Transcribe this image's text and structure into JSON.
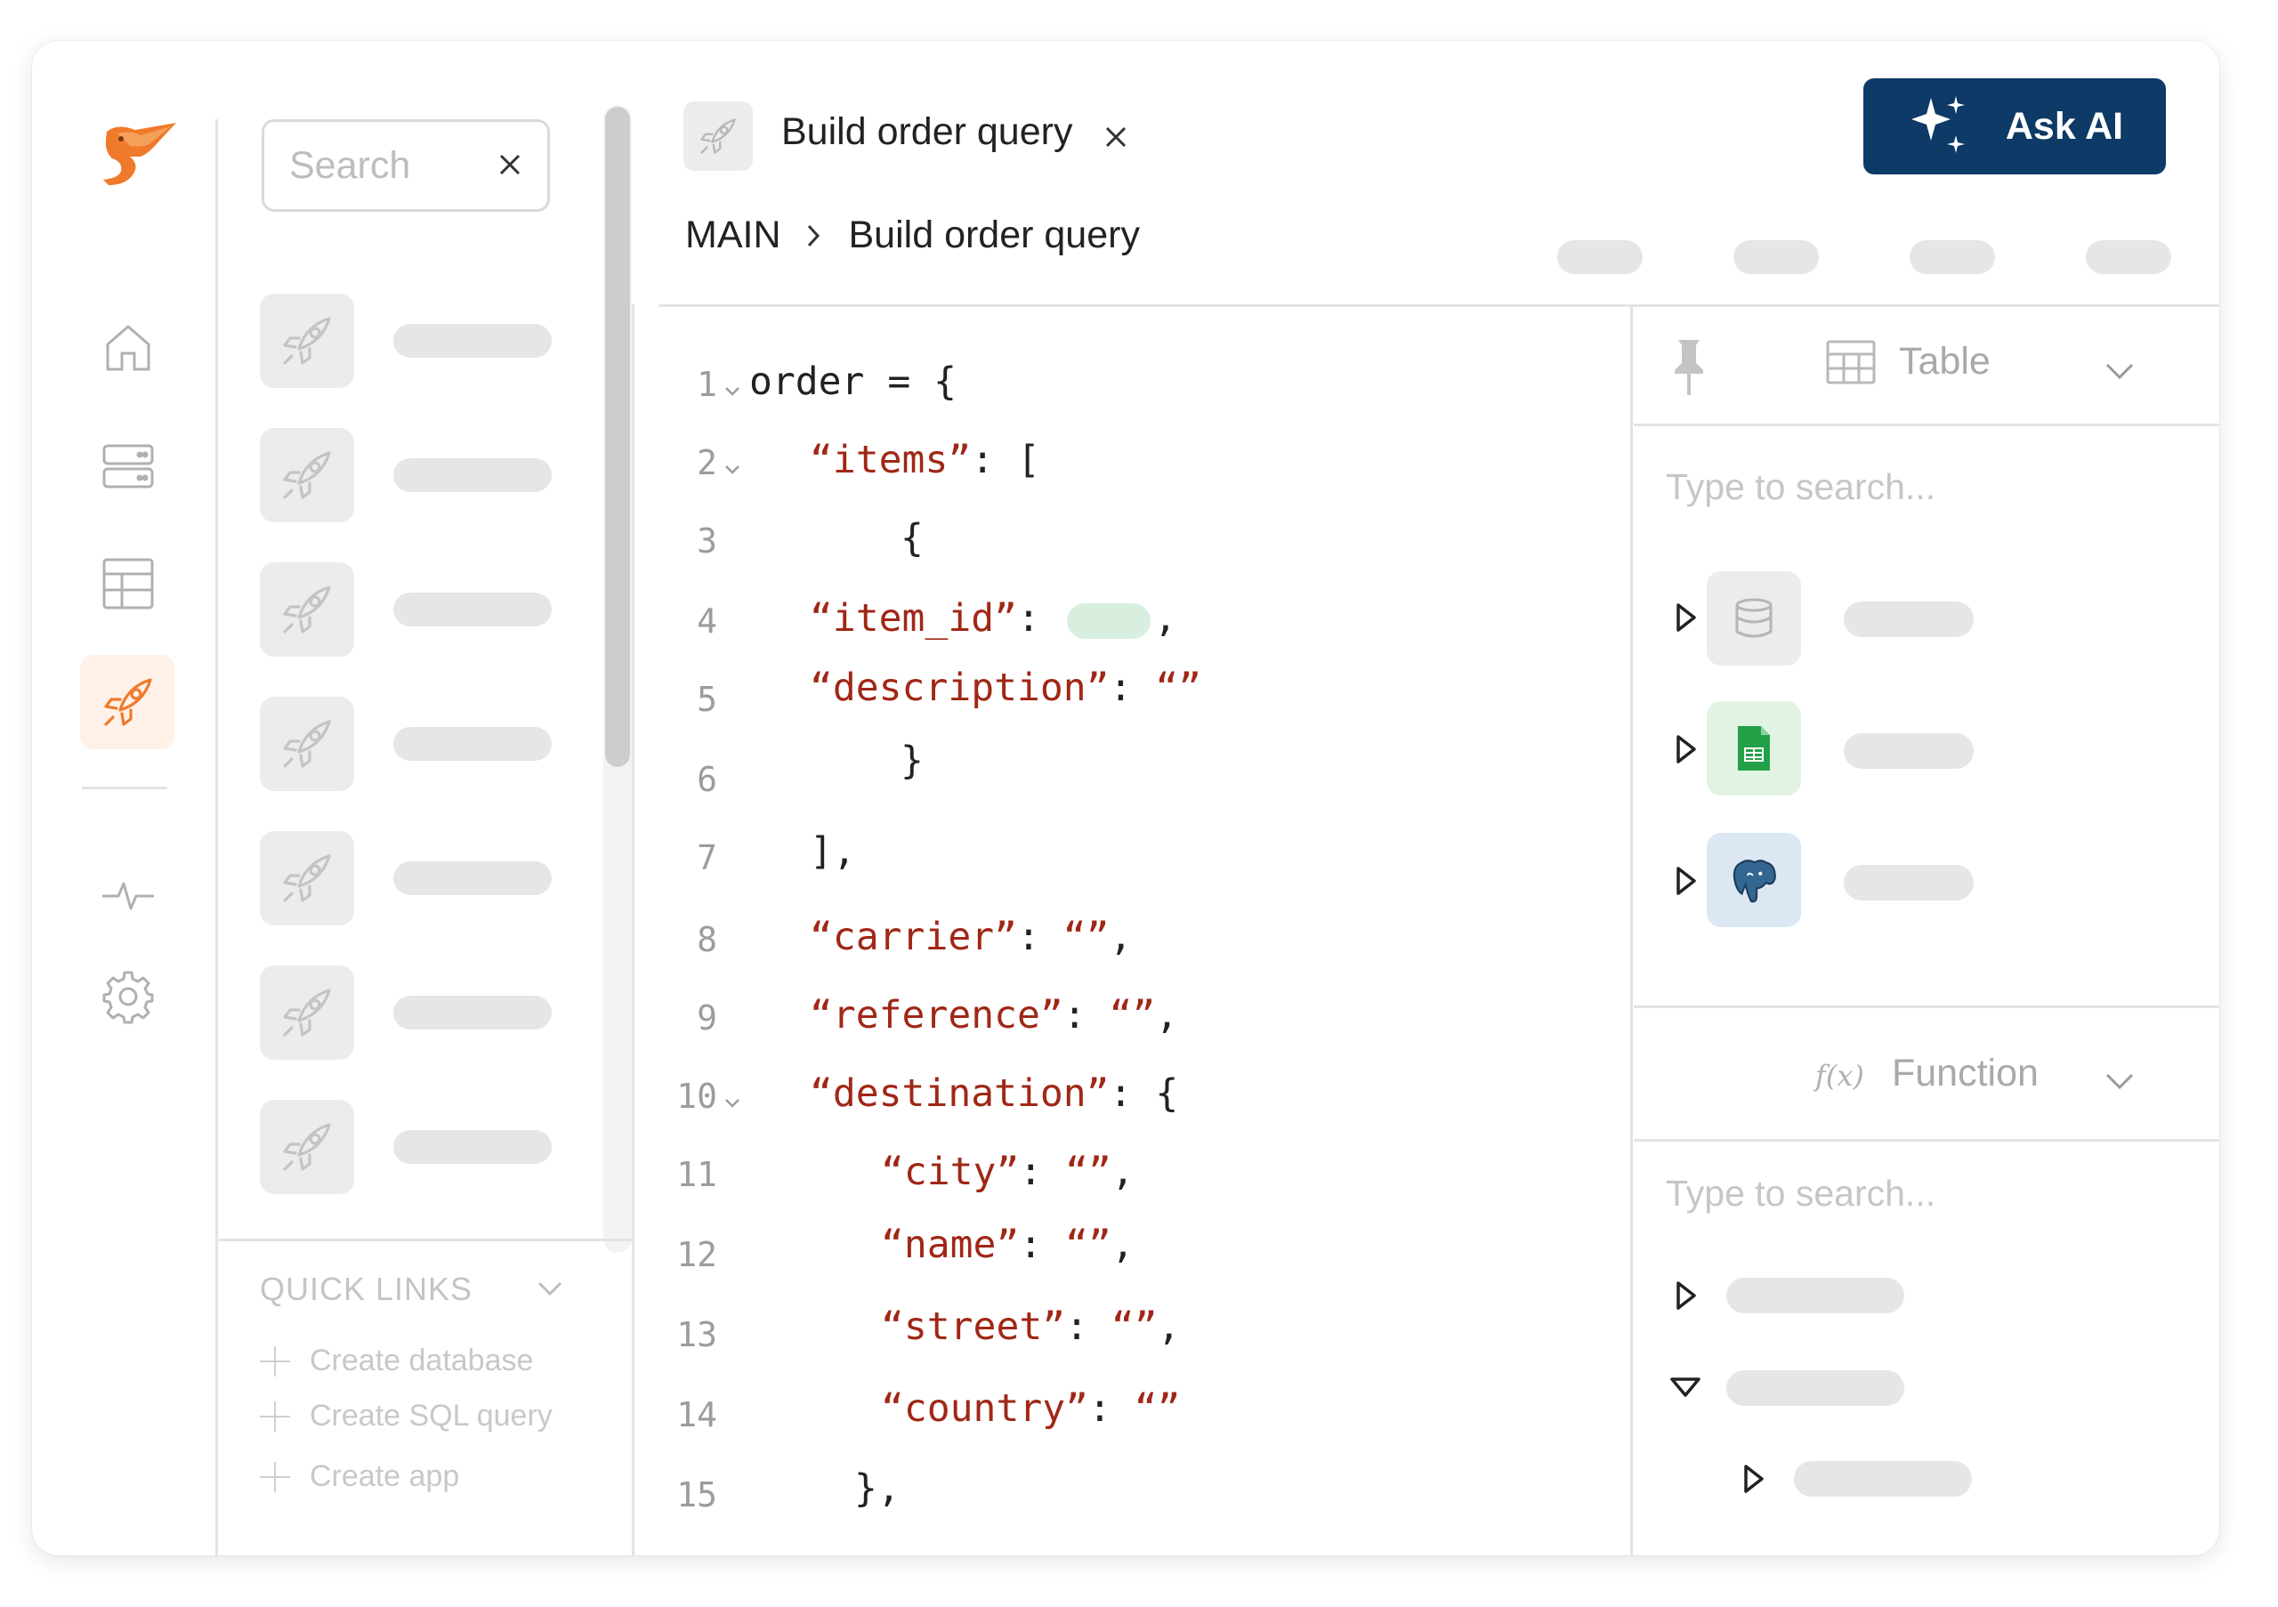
{
  "sidebar": {
    "nav": [
      "home-icon",
      "server-icon",
      "table-icon",
      "rocket-icon",
      "activity-icon",
      "gear-icon"
    ],
    "active_item": "rocket-icon",
    "accent_color": "#f07a2b"
  },
  "list_panel": {
    "search_placeholder": "Search",
    "quick_links": {
      "title": "QUICK LINKS",
      "items": [
        "Create database",
        "Create SQL query",
        "Create app"
      ]
    }
  },
  "header": {
    "tab_title": "Build order query",
    "breadcrumb": {
      "root": "MAIN",
      "current": "Build order query"
    },
    "ask_ai_label": "Ask AI",
    "ask_ai_color": "#0d3a66"
  },
  "editor": {
    "line_numbers": [
      "1",
      "2",
      "3",
      "4",
      "5",
      "6",
      "7",
      "8",
      "9",
      "10",
      "11",
      "12",
      "13",
      "14",
      "15"
    ]
  },
  "right_panel": {
    "table_section": {
      "label": "Table",
      "search_placeholder": "Type to search..."
    },
    "function_section": {
      "label": "Function",
      "prefix": "f(x)",
      "search_placeholder": "Type to search..."
    }
  }
}
